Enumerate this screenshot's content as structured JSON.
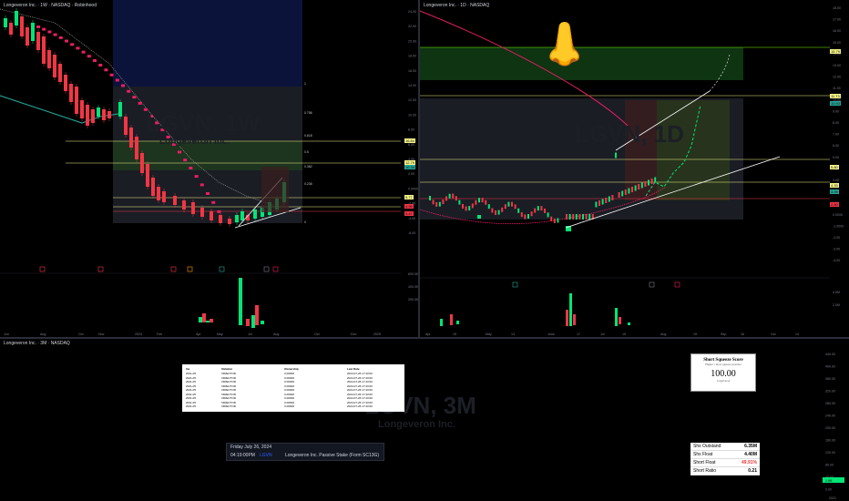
{
  "left_chart": {
    "header": "Longeveron Inc. · 1W · NASDAQ · Robinhood",
    "watermark": "LGVN, 1W",
    "watermark_sub": "Longeveron Inc.",
    "x_labels": [
      "Jun",
      "Aug",
      "Oct",
      "Nov",
      "2024",
      "Feb",
      "Apr",
      "May",
      "Jul",
      "Aug",
      "Oct",
      "Dec",
      "2025"
    ],
    "price_labels": [
      "24.00",
      "22.00",
      "20.00",
      "18.00",
      "16.00",
      "14.00",
      "12.00",
      "10.00",
      "8.00",
      "6.00",
      "4.00",
      "2.00",
      "0.0000",
      "-2.00",
      "-4.00",
      "-6.00"
    ],
    "vol_labels": [
      "600.0K",
      "400.0K",
      "200.0K"
    ],
    "fib_labels": [
      "1",
      "0.786",
      "0.618",
      "0.5",
      "0.382",
      "0.236",
      "0"
    ],
    "tags": [
      {
        "text": "16.84",
        "color": "#f5f587"
      },
      {
        "text": "12.79",
        "color": "#f5f587"
      },
      {
        "text": "10.34",
        "color": "#26a69a"
      },
      {
        "text": "5.77",
        "color": "#f5f587"
      },
      {
        "text": "4.95",
        "color": "#f23645"
      },
      {
        "text": "3.47",
        "color": "#f23645"
      }
    ]
  },
  "right_chart": {
    "header": "Longeveron Inc. · 1D · NASDAQ",
    "watermark": "LGVN, 1D",
    "x_labels": [
      "Apr",
      "15",
      "May",
      "13",
      "June",
      "17",
      "Jul",
      "15",
      "Aug",
      "19",
      "Sep",
      "16",
      "Oct",
      "14"
    ],
    "price_labels": [
      "18.00",
      "17.00",
      "16.00",
      "15.00",
      "14.00",
      "13.00",
      "12.00",
      "11.00",
      "10.00",
      "9.00",
      "8.00",
      "7.00",
      "6.00",
      "5.00",
      "4.00",
      "3.00",
      "2.00",
      "1.00",
      "0.0000",
      "-1.0000",
      "-2.00",
      "-3.00",
      "-4.00"
    ],
    "vol_labels": [
      "4.0M",
      "2.0M"
    ],
    "tags": [
      {
        "text": "15.79",
        "color": "#f5f587"
      },
      {
        "text": "11.73",
        "color": "#f5f587"
      },
      {
        "text": "10.93",
        "color": "#26a69a"
      },
      {
        "text": "5.80",
        "color": "#f5f587"
      },
      {
        "text": "4.33",
        "color": "#f5f587"
      },
      {
        "text": "3.99",
        "color": "#26a69a"
      },
      {
        "text": "2.80",
        "color": "#f23645"
      }
    ],
    "emoji": "👃"
  },
  "bottom_chart": {
    "header": "Longeveron Inc. · 3M · NASDAQ",
    "watermark": "LGVN, 3M",
    "watermark_sub": "Longeveron Inc.",
    "y_labels": [
      "440.00",
      "400.00",
      "360.00",
      "320.00",
      "280.00",
      "240.00",
      "200.00",
      "160.00",
      "120.00",
      "80.00",
      "40.00",
      "0.00"
    ],
    "last_price": "1.98",
    "year_label": "2021"
  },
  "insider_table": {
    "headers": [
      "Ins",
      "Relation",
      "Ownership",
      "Last Date"
    ],
    "rows": [
      [
        "2021-05",
        "DIRECTOR",
        "0.00000",
        "2024-07-26 17:43:00"
      ],
      [
        "2021-05",
        "DIRECTOR",
        "0.00000",
        "2024-07-26 17:43:00"
      ],
      [
        "2021-05",
        "DIRECTOR",
        "0.00000",
        "2024-07-26 17:43:00"
      ],
      [
        "2021-05",
        "DIRECTOR",
        "0.00000",
        "2024-07-26 17:43:00"
      ],
      [
        "2021-05",
        "DIRECTOR",
        "0.00000",
        "2024-07-26 17:43:00"
      ],
      [
        "2021-05",
        "DIRECTOR",
        "0.00000",
        "2024-07-26 17:43:00"
      ],
      [
        "2021-05",
        "DIRECTOR",
        "0.00000",
        "2024-07-26 17:43:00"
      ],
      [
        "2021-05",
        "DIRECTOR",
        "0.00000",
        "2024-07-26 17:43:00"
      ],
      [
        "2021-05",
        "DIRECTOR",
        "0.00000",
        "2024-07-26 17:43:00"
      ]
    ]
  },
  "news": {
    "date": "Friday July 26, 2024",
    "time": "04:19:00PM",
    "ticker": "LGVN",
    "headline": "Longeveron Inc. Passive Stake (Form SC13G)"
  },
  "short_squeeze": {
    "title": "Short Squeeze Score",
    "subtitle": "Higher = more squeeze potential",
    "score": "100.00",
    "footer": "Longeveron"
  },
  "float_table": {
    "rows": [
      {
        "label": "Shs Outstand",
        "value": "6.35M",
        "color": "#000000"
      },
      {
        "label": "Shs Float",
        "value": "4.40M",
        "color": "#000000"
      },
      {
        "label": "Short Float",
        "value": "49.91%",
        "color": "#e53935"
      },
      {
        "label": "Short Ratio",
        "value": "0.21",
        "color": "#000000"
      }
    ]
  },
  "chart_data": [
    {
      "type": "candlestick",
      "title": "LGVN, 1W",
      "x": [
        "Jun",
        "Aug",
        "Oct",
        "Nov",
        "2024",
        "Feb",
        "Apr",
        "May",
        "Jul",
        "Aug"
      ],
      "close_approx": [
        18.5,
        17.0,
        14.0,
        12.5,
        8.0,
        3.5,
        1.8,
        1.5,
        2.5,
        5.8
      ],
      "ylim": [
        -6,
        24
      ]
    },
    {
      "type": "candlestick",
      "title": "LGVN, 1D",
      "x": [
        "Apr",
        "15",
        "May",
        "13",
        "June",
        "17",
        "Jul",
        "15",
        "Aug"
      ],
      "close_approx": [
        3.2,
        2.9,
        2.5,
        2.0,
        1.5,
        1.2,
        4.0,
        3.6,
        5.8
      ],
      "ylim": [
        -4,
        18
      ]
    }
  ]
}
